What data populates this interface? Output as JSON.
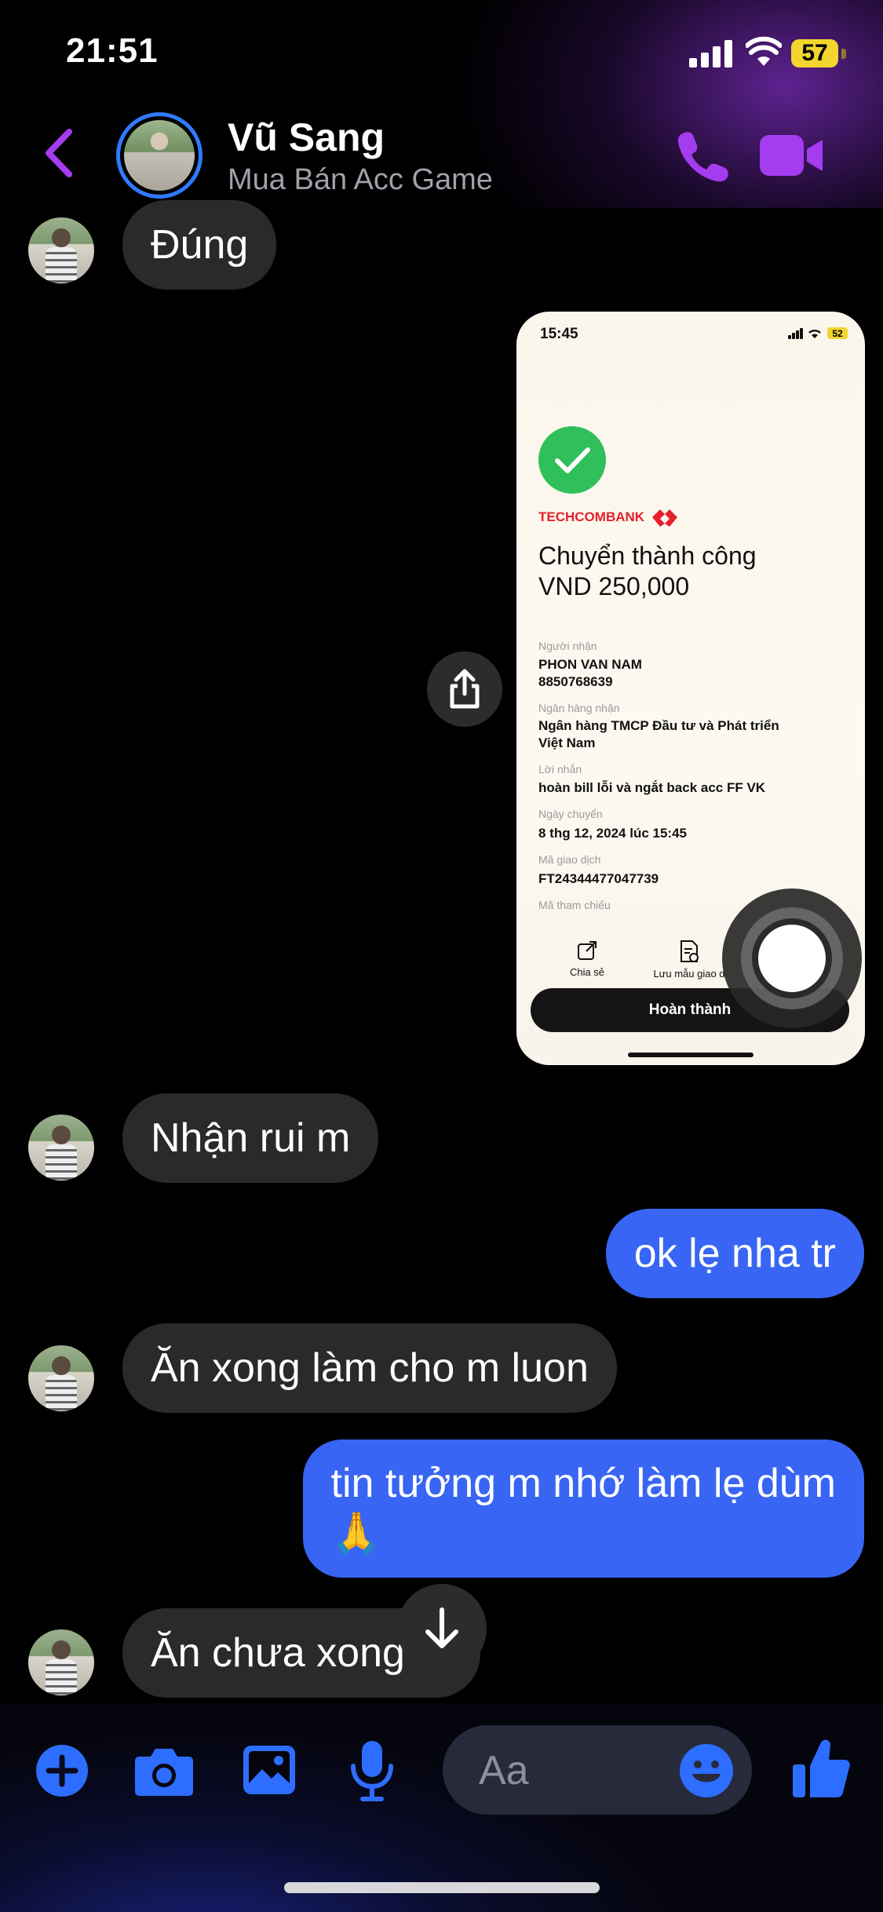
{
  "status_bar": {
    "time": "21:51",
    "battery": "57"
  },
  "header": {
    "name": "Vũ Sang",
    "subtitle": "Mua Bán Acc Game"
  },
  "messages": [
    {
      "from": "them",
      "text": "Đúng"
    },
    {
      "from": "them",
      "type": "image"
    },
    {
      "from": "them",
      "text": "Nhận rui m"
    },
    {
      "from": "me",
      "text": "ok lẹ nha tr"
    },
    {
      "from": "them",
      "text": "Ăn xong làm cho m luon"
    },
    {
      "from": "me",
      "text_line1": "tin tưởng m nhớ làm lẹ dùm",
      "text_line2": "🙏"
    },
    {
      "from": "them",
      "text": "Ăn chưa xong ơi"
    }
  ],
  "receipt": {
    "time": "15:45",
    "battery": "52",
    "bank": "TECHCOMBANK",
    "title_line1": "Chuyển thành công",
    "title_line2": "VND 250,000",
    "recipient_label": "Người nhận",
    "recipient_name": "PHON VAN NAM",
    "recipient_account": "8850768639",
    "bank_label": "Ngân hàng nhận",
    "bank_name_line1": "Ngân hàng TMCP Đầu tư và Phát triển",
    "bank_name_line2": "Việt Nam",
    "message_label": "Lời nhắn",
    "message": "hoàn bill lỗi và ngắt back acc FF VK",
    "date_label": "Ngày chuyển",
    "date": "8 thg 12, 2024 lúc 15:45",
    "txn_label": "Mã giao dịch",
    "txn": "FT24344477047739",
    "ref_label": "Mã tham chiếu",
    "share_label": "Chia sẻ",
    "save_label": "Lưu mẫu giao d",
    "done_label": "Hoàn thành"
  },
  "composer": {
    "placeholder": "Aa"
  },
  "colors": {
    "accent_purple": "#a43cf0",
    "accent_blue": "#2d6dff",
    "outgoing_bubble": "#3865f3",
    "incoming_bubble": "#2a2a2c"
  }
}
